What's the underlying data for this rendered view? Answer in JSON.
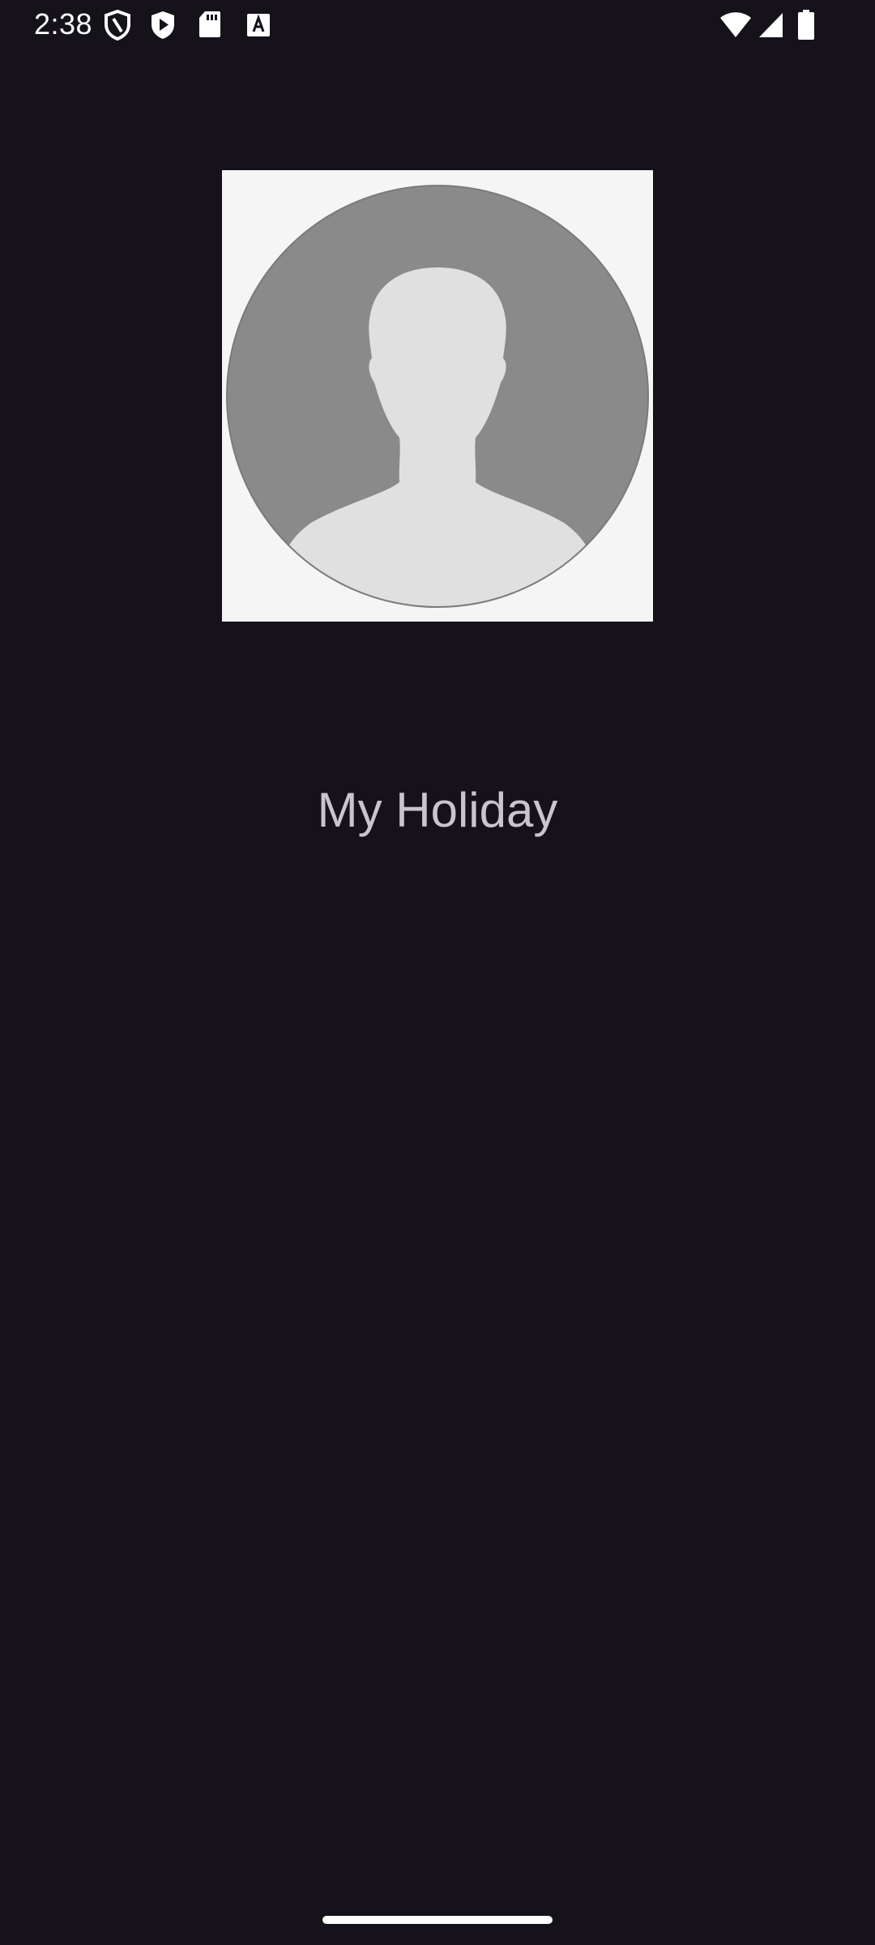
{
  "colors": {
    "background": "#15121a",
    "status_text": "#ffffff",
    "title_text": "#c9c4cf",
    "avatar_bg": "#f5f5f5",
    "avatar_circle": "#8a8a8a",
    "avatar_silhouette": "#e0e0e0",
    "gesture_bar": "#ffffff"
  },
  "status_bar": {
    "time": "2:38",
    "left_icons": [
      "shield-icon",
      "play-protect-icon",
      "sd-card-icon",
      "keyboard-a-icon"
    ],
    "right_icons": [
      "wifi-icon",
      "cellular-signal-icon",
      "battery-icon"
    ]
  },
  "profile": {
    "avatar_icon": "default-person-avatar-icon"
  },
  "main": {
    "title": "My Holiday"
  },
  "nav": {
    "type": "gesture-handle"
  }
}
